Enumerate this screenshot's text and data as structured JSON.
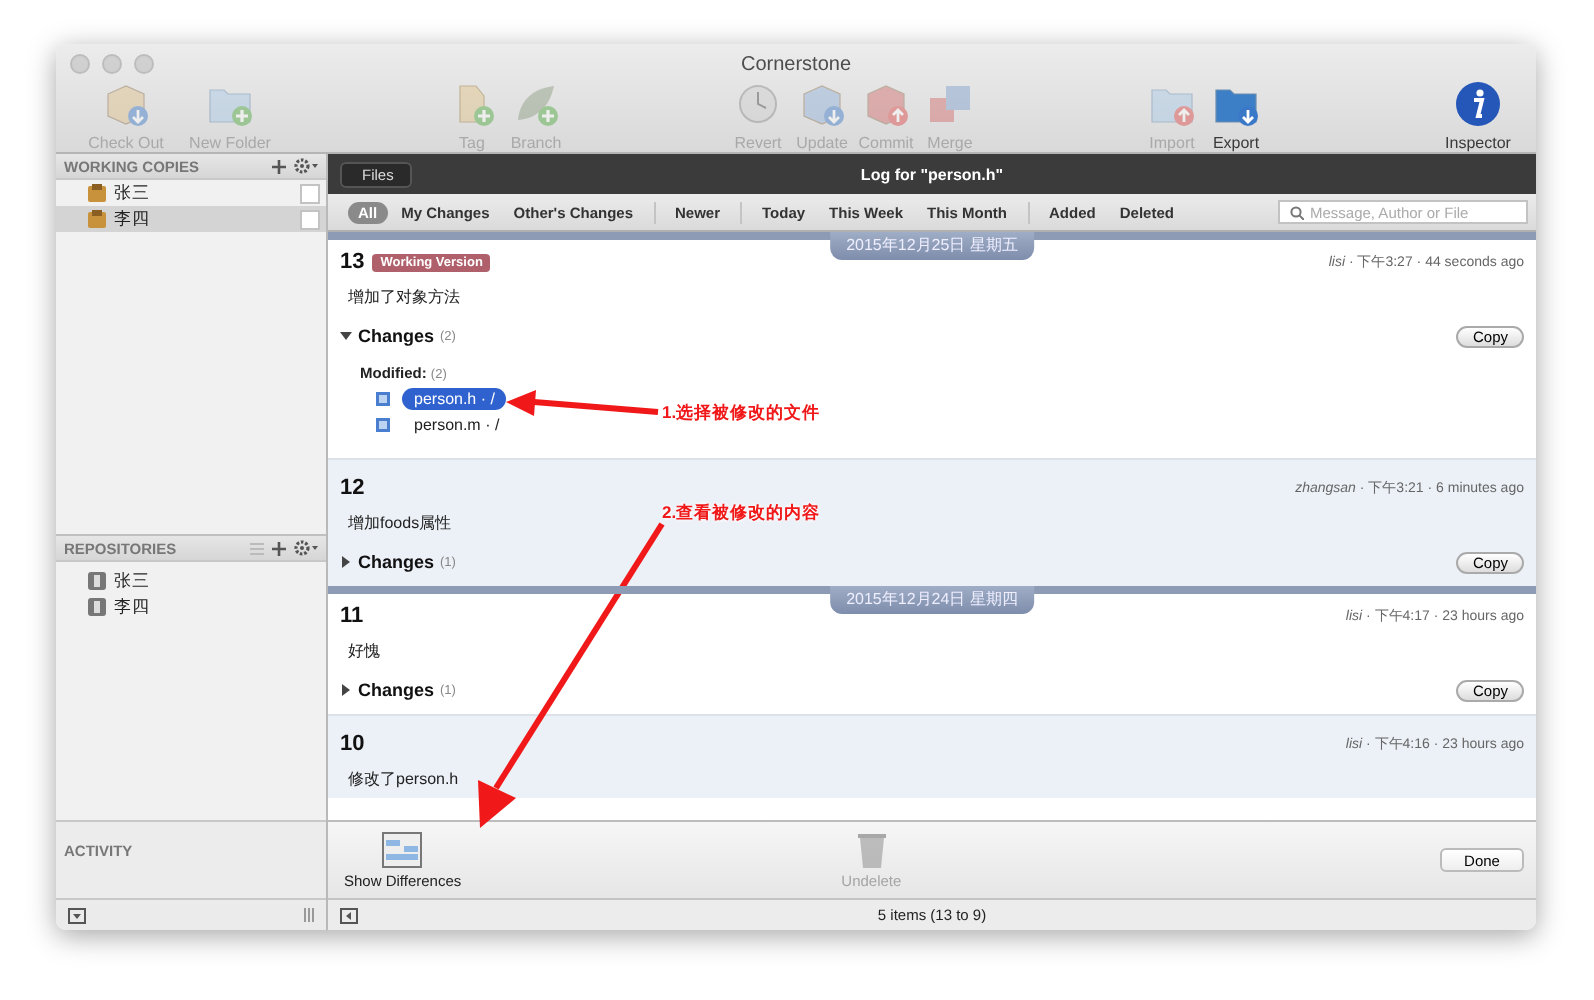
{
  "window": {
    "title": "Cornerstone"
  },
  "toolbar": {
    "groups": [
      {
        "items": [
          {
            "label": "Check Out",
            "disabled": true
          },
          {
            "label": "New Folder",
            "disabled": true
          }
        ]
      },
      {
        "items": [
          {
            "label": "Tag",
            "disabled": true
          },
          {
            "label": "Branch",
            "disabled": true
          }
        ]
      },
      {
        "items": [
          {
            "label": "Revert",
            "disabled": true
          },
          {
            "label": "Update",
            "disabled": true
          },
          {
            "label": "Commit",
            "disabled": true
          },
          {
            "label": "Merge",
            "disabled": true
          }
        ]
      },
      {
        "items": [
          {
            "label": "Import",
            "disabled": true
          },
          {
            "label": "Export",
            "disabled": false
          }
        ]
      },
      {
        "items": [
          {
            "label": "Inspector",
            "disabled": false
          }
        ]
      }
    ]
  },
  "sidebar": {
    "working_copies": {
      "title": "WORKING COPIES",
      "items": [
        {
          "label": "张三",
          "selected": false,
          "checked": false
        },
        {
          "label": "李四",
          "selected": true,
          "checked": false
        }
      ]
    },
    "repositories": {
      "title": "REPOSITORIES",
      "items": [
        {
          "label": "张三",
          "selected": false
        },
        {
          "label": "李四",
          "selected": false
        }
      ]
    },
    "activity": {
      "title": "ACTIVITY"
    }
  },
  "log": {
    "back_button": "Files",
    "title": "Log for \"person.h\"",
    "filter_groups": [
      [
        {
          "label": "All",
          "selected": true
        },
        {
          "label": "My Changes",
          "selected": false
        },
        {
          "label": "Other's Changes",
          "selected": false
        }
      ],
      [
        {
          "label": "Newer",
          "selected": false
        }
      ],
      [
        {
          "label": "Today",
          "selected": false
        },
        {
          "label": "This Week",
          "selected": false
        },
        {
          "label": "This Month",
          "selected": false
        }
      ],
      [
        {
          "label": "Added",
          "selected": false
        },
        {
          "label": "Deleted",
          "selected": false
        }
      ]
    ],
    "search": {
      "placeholder": "Message, Author or File"
    },
    "entries": [
      {
        "kind": "date",
        "label": "2015年12月25日 星期五"
      },
      {
        "kind": "revision",
        "number": "13",
        "badge": "Working Version",
        "meta": "*lisi* · 下午3:27 · 44 seconds ago",
        "message": "增加了对象方法",
        "copy": "Copy",
        "changes": {
          "label": "Changes",
          "count": "(2)",
          "expanded": true,
          "groups": [
            {
              "label": "Modified:",
              "count": "(2)",
              "files": [
                {
                  "name": "person.h · /",
                  "selected": true
                },
                {
                  "name": "person.m · /",
                  "selected": false
                }
              ]
            }
          ]
        }
      },
      {
        "kind": "revision",
        "number": "12",
        "meta": "*zhangsan* · 下午3:21 · 6 minutes ago",
        "message": "增加foods属性",
        "copy": "Copy",
        "changes": {
          "label": "Changes",
          "count": "(1)",
          "expanded": false
        }
      },
      {
        "kind": "date",
        "label": "2015年12月24日 星期四"
      },
      {
        "kind": "revision",
        "number": "11",
        "meta": "*lisi* · 下午4:17 · 23 hours ago",
        "message": "好愧",
        "copy": "Copy",
        "changes": {
          "label": "Changes",
          "count": "(1)",
          "expanded": false
        }
      },
      {
        "kind": "revision",
        "number": "10",
        "meta": "*lisi* · 下午4:16 · 23 hours ago",
        "message": "修改了person.h"
      }
    ],
    "actions": [
      {
        "label": "Show Differences",
        "disabled": false
      },
      {
        "label": "Undelete",
        "disabled": true
      }
    ],
    "done_button": "Done",
    "status": "5 items (13 to 9)"
  },
  "annotations": [
    {
      "text": "1.选择被修改的文件"
    },
    {
      "text": "2.查看被修改的内容"
    }
  ]
}
